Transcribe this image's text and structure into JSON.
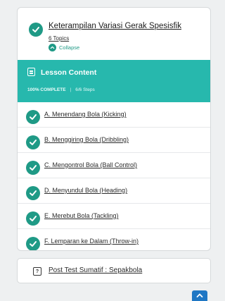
{
  "topic": {
    "title": "Keterampilan Variasi Gerak Spesisfik",
    "topics_count": "6 Topics",
    "collapse_label": "Collapse"
  },
  "lesson_content": {
    "title": "Lesson Content",
    "percent_complete": "100% COMPLETE",
    "separator": "|",
    "steps": "6/6 Steps",
    "progress": 1.0
  },
  "lessons": [
    {
      "label": "A. Menendang Bola (Kicking)"
    },
    {
      "label": "B. Menggiring Bola (Dribbling)"
    },
    {
      "label": "C. Mengontrol Bola (Ball Control)"
    },
    {
      "label": "D. Menyundul Bola (Heading)"
    },
    {
      "label": "E. Merebut Bola (Tackling)"
    },
    {
      "label": "F. Lemparan ke Dalam (Throw-in)"
    }
  ],
  "quiz": {
    "label": "Post Test Sumatif : Sepakbola",
    "icon": "?"
  },
  "colors": {
    "accent": "#1f9a86",
    "header_bg": "#27b8ad",
    "scroll_button": "#1f77c4"
  },
  "icons": {
    "check": "check-circle-icon",
    "collapse": "chevron-up-icon",
    "lesson": "document-icon",
    "quiz": "quiz-icon",
    "scroll_top": "arrow-up-icon"
  }
}
